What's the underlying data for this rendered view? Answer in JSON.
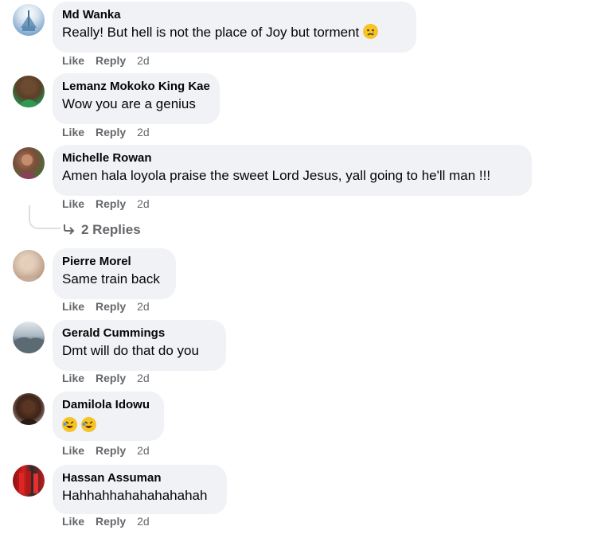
{
  "comments": [
    {
      "author": "Md Wanka",
      "text": "Really! But hell is not the place of Joy but torment",
      "like": "Like",
      "reply": "Reply",
      "time": "2d"
    },
    {
      "author": "Lemanz Mokoko King Kae",
      "text": "Wow you are a genius",
      "like": "Like",
      "reply": "Reply",
      "time": "2d"
    },
    {
      "author": "Michelle Rowan",
      "text": "Amen hala loyola praise the sweet Lord Jesus, yall going to he'll man !!!",
      "like": "Like",
      "reply": "Reply",
      "time": "2d"
    },
    {
      "author": "Pierre Morel",
      "text": "Same train back",
      "like": "Like",
      "reply": "Reply",
      "time": "2d"
    },
    {
      "author": "Gerald Cummings",
      "text": "Dmt will do that do you",
      "like": "Like",
      "reply": "Reply",
      "time": "2d"
    },
    {
      "author": "Damilola Idowu",
      "text": "",
      "like": "Like",
      "reply": "Reply",
      "time": "2d"
    },
    {
      "author": "Hassan Assuman",
      "text": "Hahhahhahahahahahah",
      "like": "Like",
      "reply": "Reply",
      "time": "2d"
    }
  ],
  "view_replies_label": "2 Replies",
  "icons": {
    "sad_emoji": "sad-emoji",
    "laughing_emoji": "rolling-on-floor-laughing-emoji",
    "reply_arrow": "reply-arrow-icon"
  }
}
